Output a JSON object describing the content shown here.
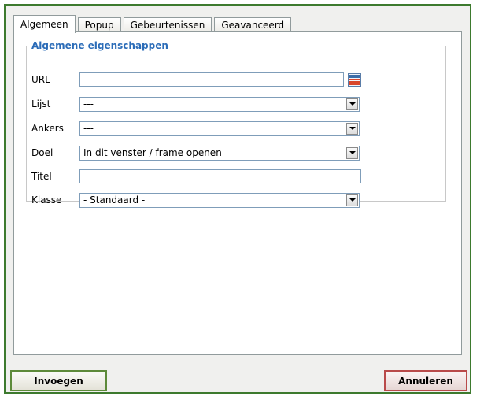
{
  "tabs": [
    {
      "label": "Algemeen",
      "active": true
    },
    {
      "label": "Popup",
      "active": false
    },
    {
      "label": "Gebeurtenissen",
      "active": false
    },
    {
      "label": "Geavanceerd",
      "active": false
    }
  ],
  "properties": {
    "legend": "Algemene eigenschappen",
    "url": {
      "label": "URL",
      "value": ""
    },
    "list": {
      "label": "Lijst",
      "value": "---"
    },
    "anchors": {
      "label": "Ankers",
      "value": "---"
    },
    "target": {
      "label": "Doel",
      "value": "In dit venster / frame openen"
    },
    "title": {
      "label": "Titel",
      "value": ""
    },
    "class": {
      "label": "Klasse",
      "value": "- Standaard -"
    }
  },
  "buttons": {
    "insert": "Invoegen",
    "cancel": "Annuleren"
  },
  "colors": {
    "frame_border": "#3d7a2e",
    "legend_text": "#2b6cb8",
    "insert_border": "#5d8a3a",
    "cancel_border": "#b94a4a"
  },
  "icons": {
    "url_browse": "browse-icon"
  }
}
